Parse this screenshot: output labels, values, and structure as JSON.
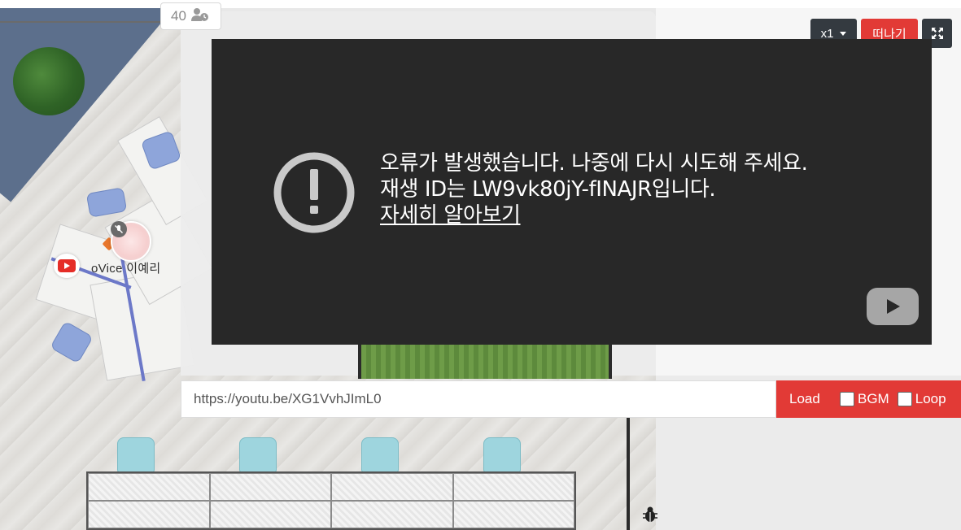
{
  "room": {
    "participant_count": "40",
    "participant_icon": "user-clock-icon"
  },
  "user": {
    "name": "oVice 이예리",
    "status_icon": "mic-muted-icon",
    "media_badge_icon": "youtube-icon"
  },
  "player": {
    "speed_label": "x1",
    "leave_label": "떠나기",
    "fullscreen_icon": "expand-icon",
    "error": {
      "icon": "exclamation-circle-icon",
      "line1": "오류가 발생했습니다. 나중에 다시 시도해 주세요.",
      "line2": "재생 ID는 LW9vk80jY-fINAJR입니다.",
      "link": "자세히 알아보기"
    },
    "logo_icon": "youtube-logo-icon",
    "url_value": "https://youtu.be/XG1VvhJImL0",
    "load_label": "Load",
    "bgm_label": "BGM",
    "loop_label": "Loop"
  },
  "colors": {
    "accent_red": "#e23a36",
    "dark_button": "#343a40",
    "video_bg": "#282828"
  }
}
